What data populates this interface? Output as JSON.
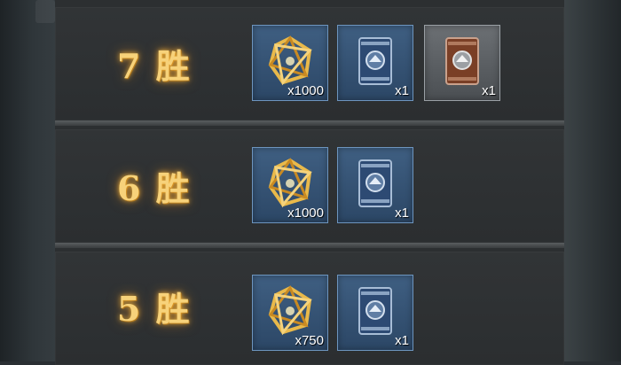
{
  "rewards": [
    {
      "wins_label": "7 胜",
      "items": [
        {
          "icon": "gold-crystal-icon",
          "qty": "x1000",
          "frame": "blue"
        },
        {
          "icon": "blue-book-icon",
          "qty": "x1",
          "frame": "blue"
        },
        {
          "icon": "brown-book-icon",
          "qty": "x1",
          "frame": "brown"
        }
      ]
    },
    {
      "wins_label": "6 胜",
      "items": [
        {
          "icon": "gold-crystal-icon",
          "qty": "x1000",
          "frame": "blue"
        },
        {
          "icon": "blue-book-icon",
          "qty": "x1",
          "frame": "blue"
        }
      ]
    },
    {
      "wins_label": "5 胜",
      "items": [
        {
          "icon": "gold-crystal-icon",
          "qty": "x750",
          "frame": "blue"
        },
        {
          "icon": "blue-book-icon",
          "qty": "x1",
          "frame": "blue"
        }
      ]
    }
  ],
  "colors": {
    "slot_blue": "#3f5f82",
    "slot_border": "#6d95bf",
    "gold_text": "#f7d27a"
  }
}
